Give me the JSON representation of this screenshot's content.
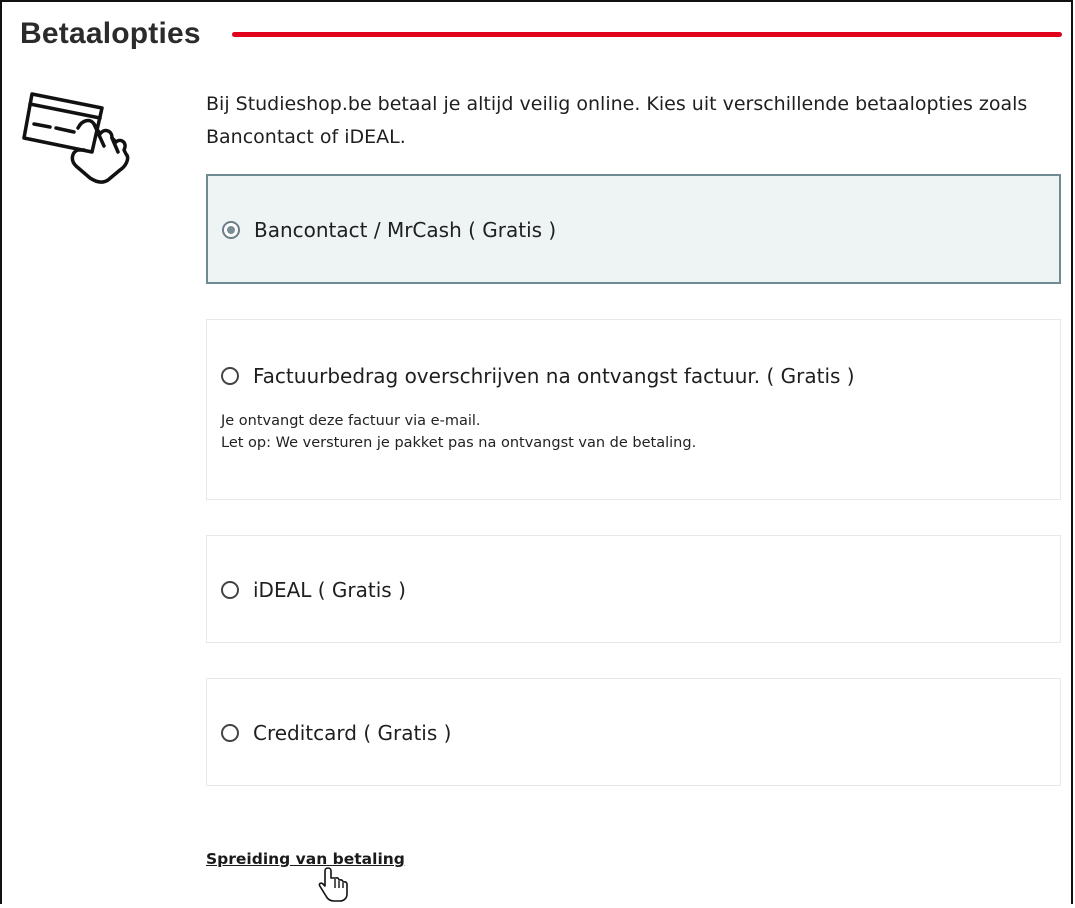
{
  "section": {
    "title": "Betaalopties",
    "accent_color": "#e2001a",
    "icon": "credit-card-hand-icon",
    "intro": "Bij Studieshop.be betaal je altijd veilig online. Kies uit verschillende betaalopties zoals Bancontact of iDEAL."
  },
  "payment_options": [
    {
      "label": "Bancontact / MrCash ( Gratis )",
      "selected": true
    },
    {
      "label": "Factuurbedrag overschrijven na ontvangst factuur. ( Gratis )",
      "selected": false,
      "description_line1": "Je ontvangt deze factuur via e-mail.",
      "description_line2": "Let op: We versturen je pakket pas na ontvangst van de betaling."
    },
    {
      "label": "iDEAL ( Gratis )",
      "selected": false
    },
    {
      "label": "Creditcard ( Gratis )",
      "selected": false
    }
  ],
  "spreading_link": "Spreiding van betaling",
  "colors": {
    "selected_bg": "#eef3f3",
    "selected_border": "#6e8a93"
  },
  "cursor": "hand-pointer-icon"
}
